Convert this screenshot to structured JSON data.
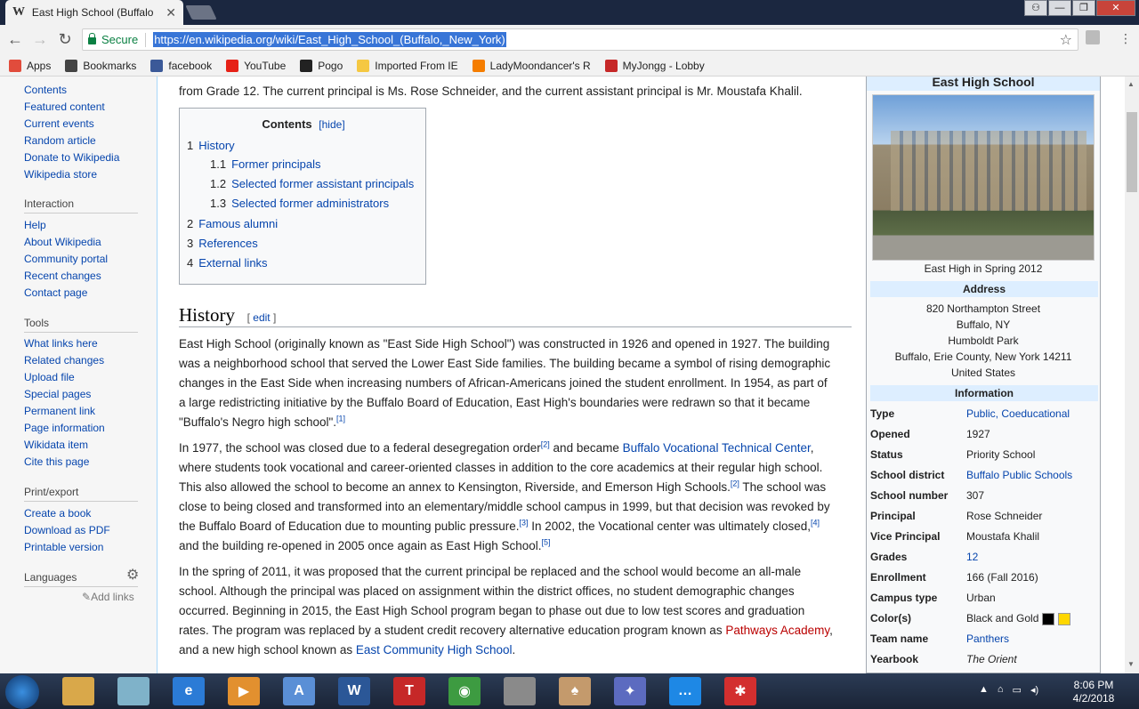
{
  "browser": {
    "tab_title": "East High School (Buffalo",
    "tab_favicon": "W",
    "secure_label": "Secure",
    "url": "https://en.wikipedia.org/wiki/East_High_School_(Buffalo,_New_York)",
    "bookmarks": [
      {
        "label": "Apps",
        "icon": "apps-grid-icon",
        "color": "#e14c3c"
      },
      {
        "label": "Bookmarks",
        "icon": "star-icon",
        "color": "#444444"
      },
      {
        "label": "facebook",
        "icon": "facebook-icon",
        "color": "#3b5998"
      },
      {
        "label": "YouTube",
        "icon": "youtube-icon",
        "color": "#e62117"
      },
      {
        "label": "Pogo",
        "icon": "pogo-icon",
        "color": "#222222"
      },
      {
        "label": "Imported From IE",
        "icon": "folder-icon",
        "color": "#f5c842"
      },
      {
        "label": "LadyMoondancer's R",
        "icon": "blogger-icon",
        "color": "#f57d00"
      },
      {
        "label": "MyJongg - Lobby",
        "icon": "pin-icon",
        "color": "#c62828"
      }
    ]
  },
  "sidebar": {
    "nav": [
      "Contents",
      "Featured content",
      "Current events",
      "Random article",
      "Donate to Wikipedia",
      "Wikipedia store"
    ],
    "interaction_heading": "Interaction",
    "interaction": [
      "Help",
      "About Wikipedia",
      "Community portal",
      "Recent changes",
      "Contact page"
    ],
    "tools_heading": "Tools",
    "tools": [
      "What links here",
      "Related changes",
      "Upload file",
      "Special pages",
      "Permanent link",
      "Page information",
      "Wikidata item",
      "Cite this page"
    ],
    "print_heading": "Print/export",
    "print": [
      "Create a book",
      "Download as PDF",
      "Printable version"
    ],
    "languages_heading": "Languages",
    "add_links": "Add links"
  },
  "article": {
    "intro_tail": "from Grade 12. The current principal is Ms. Rose Schneider, and the current assistant principal is Mr. Moustafa Khalil.",
    "toc": {
      "title": "Contents",
      "hide": "[hide]",
      "items": [
        {
          "num": "1",
          "label": "History"
        },
        {
          "num": "1.1",
          "label": "Former principals"
        },
        {
          "num": "1.2",
          "label": "Selected former assistant principals"
        },
        {
          "num": "1.3",
          "label": "Selected former administrators"
        },
        {
          "num": "2",
          "label": "Famous alumni"
        },
        {
          "num": "3",
          "label": "References"
        },
        {
          "num": "4",
          "label": "External links"
        }
      ]
    },
    "history_heading": "History",
    "edit_label": "edit",
    "para1": "East High School (originally known as \"East Side High School\") was constructed in 1926 and opened in 1927. The building was a neighborhood school that served the Lower East Side families. The building became a symbol of rising demographic changes in the East Side when increasing numbers of African-Americans joined the student enrollment. In 1954, as part of a large redistricting initiative by the Buffalo Board of Education, East High's boundaries were redrawn so that it became \"Buffalo's Negro high school\".",
    "para2": {
      "a": "In 1977, the school was closed due to a federal desegregation order",
      "b": " and became ",
      "link1": "Buffalo Vocational Technical Center",
      "c": ", where students took vocational and career-oriented classes in addition to the core academics at their regular high school. This also allowed the school to become an annex to Kensington, Riverside, and Emerson High Schools.",
      "d": " The school was close to being closed and transformed into an elementary/middle school campus in 1999, but that decision was revoked by the Buffalo Board of Education due to mounting public pressure.",
      "e": " In 2002, the Vocational center was ultimately closed,",
      "f": " and the building re-opened in 2005 once again as East High School."
    },
    "para3": {
      "a": "In the spring of 2011, it was proposed that the current principal be replaced and the school would become an all-male school. Although the principal was placed on assignment within the district offices, no student demographic changes occurred. Beginning in 2015, the East High School program began to phase out due to low test scores and graduation rates. The program was replaced by a student credit recovery alternative education program known as ",
      "link1": "Pathways Academy",
      "b": ", and a new high school known as ",
      "link2": "East Community High School",
      "c": "."
    },
    "refs": [
      "[1]",
      "[2]",
      "[2]",
      "[3]",
      "[4]",
      "[5]"
    ]
  },
  "infobox": {
    "title": "East High School",
    "caption": "East High in Spring 2012",
    "address_heading": "Address",
    "address_lines": [
      "820 Northampton Street",
      "Buffalo, NY",
      "Humboldt Park",
      "Buffalo, Erie County, New York 14211",
      "United States"
    ],
    "information_heading": "Information",
    "rows": [
      {
        "label": "Type",
        "value": "Public, Coeducational",
        "link": true
      },
      {
        "label": "Opened",
        "value": "1927",
        "link": false
      },
      {
        "label": "Status",
        "value": "Priority School",
        "link": false
      },
      {
        "label": "School district",
        "value": "Buffalo Public Schools",
        "link": true
      },
      {
        "label": "School number",
        "value": "307",
        "link": false
      },
      {
        "label": "Principal",
        "value": "Rose Schneider",
        "link": false
      },
      {
        "label": "Vice Principal",
        "value": "Moustafa Khalil",
        "link": false
      },
      {
        "label": "Grades",
        "value": "12",
        "link": true
      },
      {
        "label": "Enrollment",
        "value": "166 (Fall 2016)",
        "link": false
      },
      {
        "label": "Campus type",
        "value": "Urban",
        "link": false
      },
      {
        "label": "Color(s)",
        "value": "Black and Gold",
        "link": false
      },
      {
        "label": "Team name",
        "value": "Panthers",
        "link": true
      },
      {
        "label": "Yearbook",
        "value": "The Orient",
        "link": false
      }
    ],
    "color_swatches": [
      "#000000",
      "#ffd700"
    ]
  },
  "taskbar": {
    "clock_time": "8:06 PM",
    "clock_date": "4/2/2018",
    "apps": [
      {
        "name": "file-explorer-icon",
        "color": "#d9a84a",
        "glyph": ""
      },
      {
        "name": "notepad-icon",
        "color": "#7fb2c9",
        "glyph": ""
      },
      {
        "name": "internet-explorer-icon",
        "color": "#2b7bd6",
        "glyph": "e"
      },
      {
        "name": "media-player-icon",
        "color": "#e2902f",
        "glyph": "▶"
      },
      {
        "name": "wordpad-icon",
        "color": "#5a8fd6",
        "glyph": "A"
      },
      {
        "name": "word-icon",
        "color": "#2b5797",
        "glyph": "W"
      },
      {
        "name": "text-app-icon",
        "color": "#c62828",
        "glyph": "T"
      },
      {
        "name": "chrome-icon",
        "color": "#3d9b41",
        "glyph": "◉"
      },
      {
        "name": "scanner-icon",
        "color": "#8a8a8a",
        "glyph": ""
      },
      {
        "name": "cards-icon",
        "color": "#c49a6c",
        "glyph": "♠"
      },
      {
        "name": "mahjong-icon",
        "color": "#5c6bc0",
        "glyph": "✦"
      },
      {
        "name": "chat-icon",
        "color": "#1e88e5",
        "glyph": "…"
      },
      {
        "name": "game-icon",
        "color": "#d32f2f",
        "glyph": "✱"
      }
    ]
  }
}
